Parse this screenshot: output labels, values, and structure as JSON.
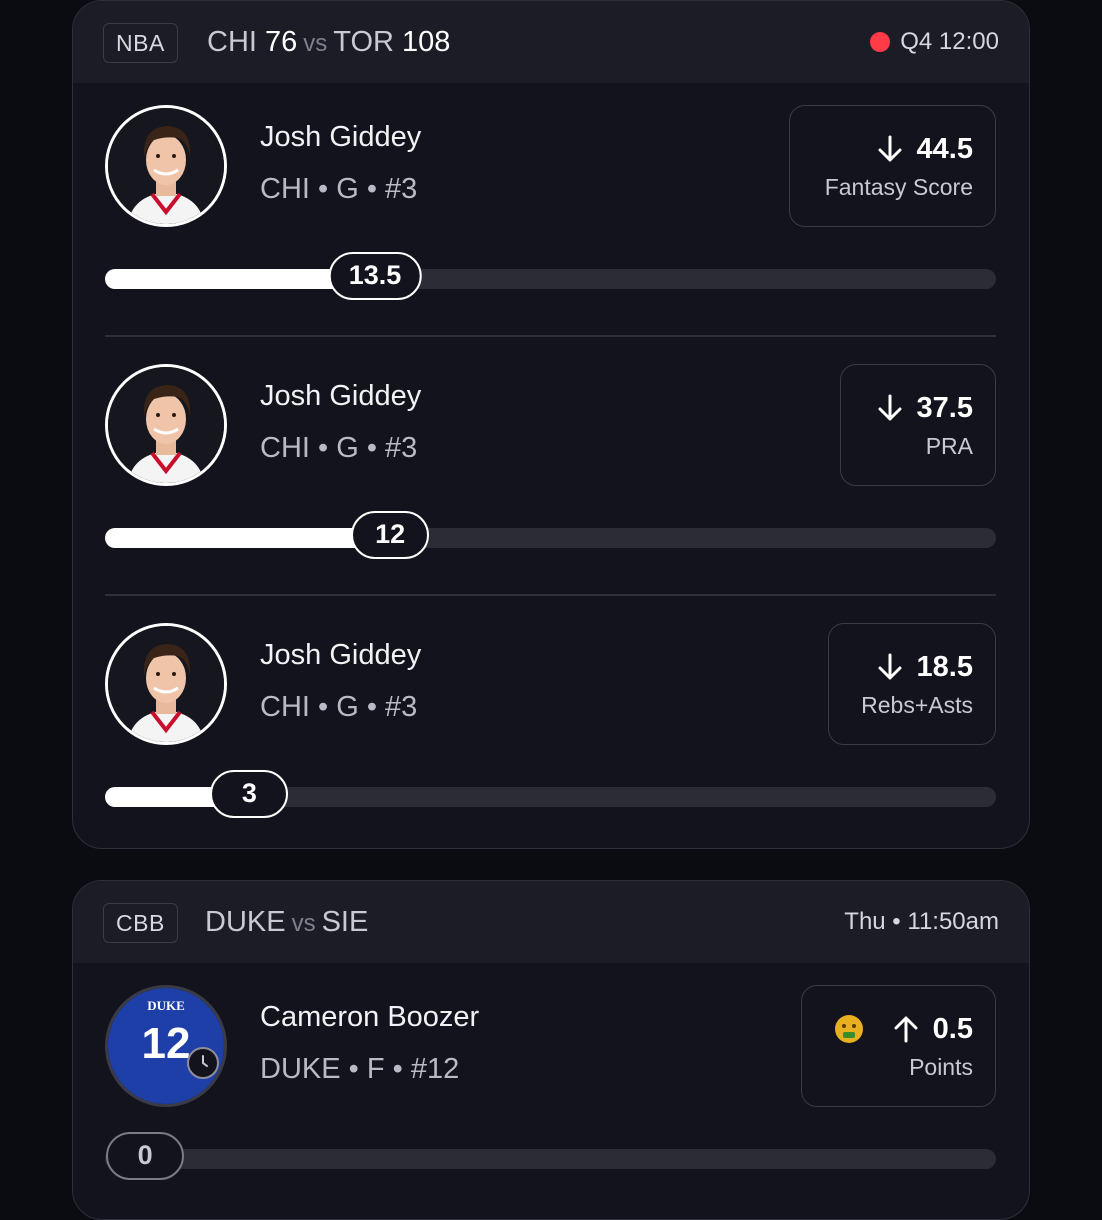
{
  "games": [
    {
      "league": "NBA",
      "team1": "CHI",
      "score1": "76",
      "vs": "vs",
      "team2": "TOR",
      "score2": "108",
      "status": "Q4 12:00",
      "live": true,
      "props": [
        {
          "player": "Josh Giddey",
          "meta": "CHI • G • #3",
          "line": "44.5",
          "stat": "Fantasy Score",
          "direction": "down",
          "current": "13.5",
          "progress": 0.303
        },
        {
          "player": "Josh Giddey",
          "meta": "CHI • G • #3",
          "line": "37.5",
          "stat": "PRA",
          "direction": "down",
          "current": "12",
          "progress": 0.32
        },
        {
          "player": "Josh Giddey",
          "meta": "CHI • G • #3",
          "line": "18.5",
          "stat": "Rebs+Asts",
          "direction": "down",
          "current": "3",
          "progress": 0.162
        }
      ]
    },
    {
      "league": "CBB",
      "team1": "DUKE",
      "vs": "vs",
      "team2": "SIE",
      "status": "Thu • 11:50am",
      "live": false,
      "props": [
        {
          "player": "Cameron Boozer",
          "meta": "DUKE • F • #12",
          "line": "0.5",
          "stat": "Points",
          "direction": "up",
          "current": "0",
          "progress": 0.045,
          "jersey_text": "DUKE",
          "jersey_number": "12",
          "emoji": "money-mouth-face-icon"
        }
      ]
    }
  ],
  "colors": {
    "background": "#0b0c12",
    "card": "#12131c",
    "header": "#1b1c26",
    "live": "#ff3b47",
    "track": "#2b2c36",
    "duke_blue": "#1f3fa8"
  }
}
